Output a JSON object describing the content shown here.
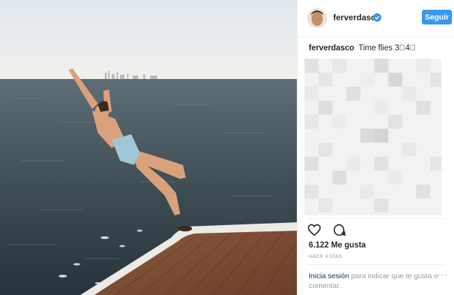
{
  "post": {
    "username": "ferverdasco",
    "follow_label": "Seguir",
    "caption_user": "ferverdasco",
    "caption_text": "Time flies",
    "caption_emoji": "3⃣4⃣",
    "likes": "6.122 Me gusta",
    "timestamp": "HACE 4 DÍAS",
    "login_link": "Inicia sesión",
    "login_text": "para indicar que te gusta o comentar.",
    "more_label": "···"
  },
  "icons": [
    "verified-badge-icon",
    "heart-icon",
    "comment-icon",
    "more-options-icon"
  ],
  "colors": {
    "accent": "#3897f0",
    "link": "#003569",
    "muted": "#999999"
  }
}
